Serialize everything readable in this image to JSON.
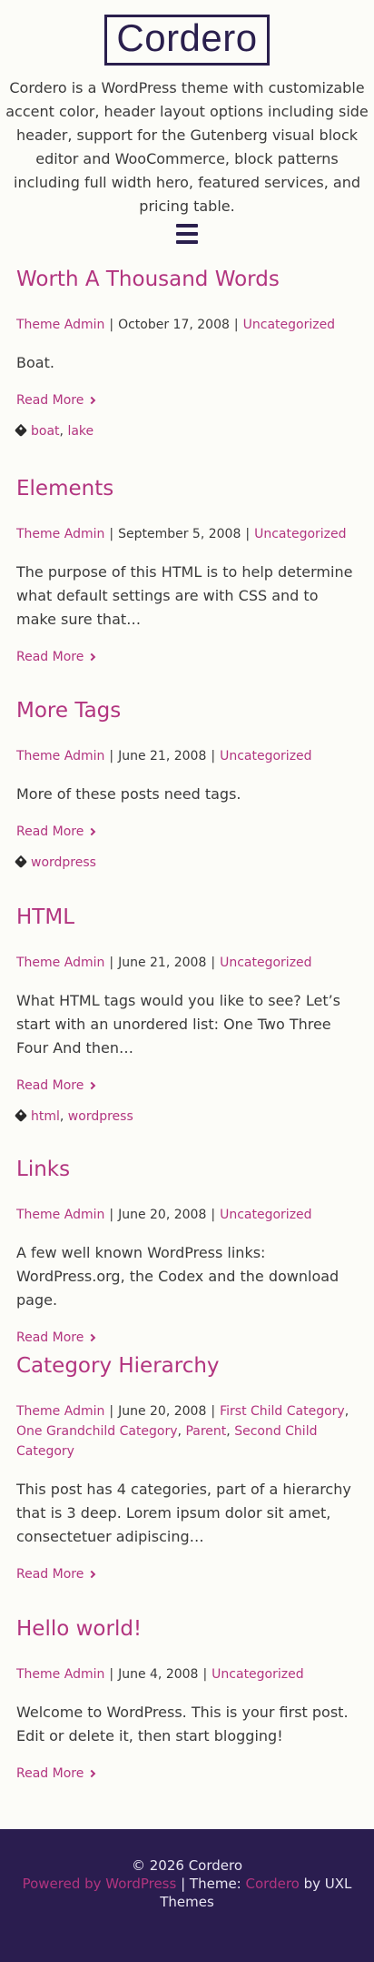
{
  "site": {
    "title": "Cordero",
    "description": "Cordero is a WordPress theme with customizable accent color, header layout options including side header, support for the Gutenberg visual block editor and WooCommerce, block patterns including full width hero, featured services, and pricing table.",
    "menu_icon": "hamburger-menu-icon"
  },
  "ui": {
    "read_more": "Read More",
    "meta_sep": "|"
  },
  "posts": [
    {
      "title": "Worth A Thousand Words",
      "author": "Theme Admin",
      "date": "October 17, 2008",
      "categories": [
        "Uncategorized"
      ],
      "excerpt": "Boat.",
      "tags": [
        "boat",
        "lake"
      ]
    },
    {
      "title": "Elements",
      "author": "Theme Admin",
      "date": "September 5, 2008",
      "categories": [
        "Uncategorized"
      ],
      "excerpt": "The purpose of this HTML is to help determine what default settings are with CSS and to make sure that…",
      "tags": []
    },
    {
      "title": "More Tags",
      "author": "Theme Admin",
      "date": "June 21, 2008",
      "categories": [
        "Uncategorized"
      ],
      "excerpt": "More of these posts need tags.",
      "tags": [
        "wordpress"
      ]
    },
    {
      "title": "HTML",
      "author": "Theme Admin",
      "date": "June 21, 2008",
      "categories": [
        "Uncategorized"
      ],
      "excerpt": "What HTML tags would you like to see? Let’s start with an unordered list: One Two Three Four And then…",
      "tags": [
        "html",
        "wordpress"
      ]
    },
    {
      "title": "Links",
      "author": "Theme Admin",
      "date": "June 20, 2008",
      "categories": [
        "Uncategorized"
      ],
      "excerpt": "A few well known WordPress links: WordPress.org, the Codex and the download page.",
      "tags": []
    },
    {
      "title": "Category Hierarchy",
      "author": "Theme Admin",
      "date": "June 20, 2008",
      "categories": [
        "First Child Category",
        "One Grandchild Category",
        "Parent",
        "Second Child Category"
      ],
      "excerpt": "This post has 4 categories, part of a hierarchy that is 3 deep. Lorem ipsum dolor sit amet, consectetuer adipiscing…",
      "tags": []
    },
    {
      "title": "Hello world!",
      "author": "Theme Admin",
      "date": "June 4, 2008",
      "categories": [
        "Uncategorized"
      ],
      "excerpt": "Welcome to WordPress. This is your first post. Edit or delete it, then start blogging!",
      "tags": []
    }
  ],
  "footer": {
    "copyright": "© 2026 Cordero",
    "powered_by": "Powered by WordPress",
    "theme_prefix": "| Theme:",
    "theme_name": "Cordero",
    "theme_suffix": "by UXL Themes"
  },
  "colors": {
    "accent": "#b2347f",
    "brand_dark": "#2a1d4f",
    "background": "#fcfcf8",
    "text": "#3a3a3a"
  }
}
